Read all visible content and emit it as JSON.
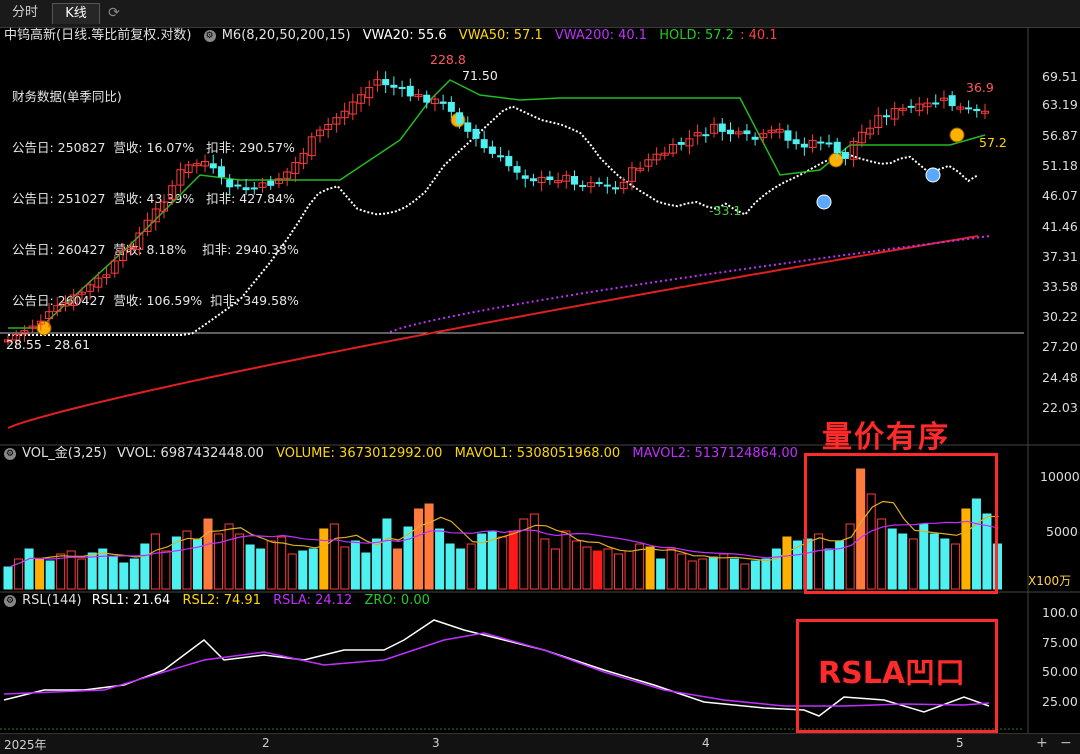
{
  "tabs": {
    "intraday": "分时",
    "kline": "K线",
    "refresh_icon": "refresh-icon"
  },
  "header": {
    "stock": "中钨高新(日线.等比前复权.对数)",
    "indicator": "M6(8,20,50,200,15)",
    "vwa20": "VWA20: 55.6",
    "vwa50": "VWA50: 57.1",
    "vwa200": "VWA200: 40.1",
    "hold": "HOLD: 57.2",
    "hold2": ": 40.1"
  },
  "finance": {
    "title": "财务数据(单季同比)",
    "rows": [
      "公告日: 250827  营收: 16.07%   扣非: 290.57%",
      "公告日: 251027  营收: 43.39%   扣非: 427.84%",
      "公告日: 260427  营收: 8.18%    扣非: 2940.33%",
      "公告日: 260427  营收: 106.59%  扣非: 349.58%"
    ]
  },
  "price_axis": [
    "69.51",
    "63.19",
    "56.87",
    "51.18",
    "46.07",
    "41.46",
    "37.31",
    "33.58",
    "30.22",
    "27.20",
    "24.48",
    "22.03"
  ],
  "annotations": {
    "high_pct": "228.8",
    "high_price": "71.50",
    "low_pct": "-33.1",
    "recent_pct": "36.9",
    "hold_value": "57.2",
    "start_label": "28.55 - 28.61"
  },
  "callouts": {
    "volume_box": "量价有序",
    "rsl_box": "RSLA凹口"
  },
  "volume": {
    "header_name": "VOL_金(3,25)",
    "vvol": "VVOL: 6987432448.00",
    "volume": "VOLUME: 3673012992.00",
    "mavol1": "MAVOL1: 5308051968.00",
    "mavol2": "MAVOL2: 5137124864.00",
    "axis": [
      "10000",
      "5000"
    ],
    "unit": "X100万"
  },
  "rsl": {
    "header_name": "RSL(144)",
    "rsl1": "RSL1: 21.64",
    "rsl2": "RSL2: 74.91",
    "rsla": "RSLA: 24.12",
    "zro": "ZRO: 0.00",
    "axis": [
      "100.0",
      "75.00",
      "50.00",
      "25.00"
    ]
  },
  "dates": {
    "d1": "2025年",
    "d2": "2",
    "d3": "3",
    "d4": "4",
    "d5": "5"
  },
  "controls": {
    "plus": "+",
    "minus": "−"
  },
  "colors": {
    "up": "#ff3b3b",
    "down": "#4ff0f0",
    "vwa20": "#ffffff",
    "vwa50": "#ffd700",
    "vwa200": "#c030ff",
    "hold": "#22bb22",
    "callout": "#ff2a2a",
    "orange": "#ff7a3d",
    "yellow": "#ffb000"
  }
}
